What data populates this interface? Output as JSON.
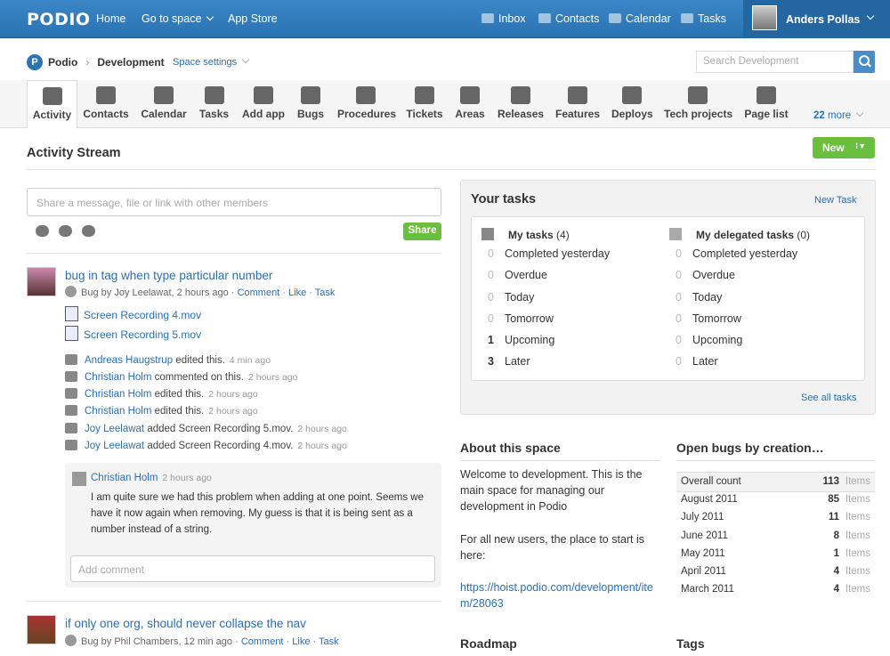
{
  "topbar": {
    "logo": "PODIO",
    "nav": [
      "Home",
      "Go to space",
      "App Store"
    ],
    "right_nav": [
      "Inbox",
      "Contacts",
      "Calendar",
      "Tasks"
    ],
    "user": "Anders Pollas"
  },
  "space": {
    "org": "Podio",
    "name": "Development",
    "settings": "Space settings",
    "search_placeholder": "Search Development"
  },
  "apps": [
    {
      "label": "Activity",
      "icon": "activity-icon"
    },
    {
      "label": "Contacts",
      "icon": "contacts-icon"
    },
    {
      "label": "Calendar",
      "icon": "calendar-icon"
    },
    {
      "label": "Tasks",
      "icon": "tasks-icon"
    },
    {
      "label": "Add app",
      "icon": "add-app-icon"
    },
    {
      "label": "Bugs",
      "icon": "bug-icon"
    },
    {
      "label": "Procedures",
      "icon": "book-icon"
    },
    {
      "label": "Tickets",
      "icon": "ticket-icon"
    },
    {
      "label": "Areas",
      "icon": "cloud-icon"
    },
    {
      "label": "Releases",
      "icon": "checkmark-icon"
    },
    {
      "label": "Features",
      "icon": "hammer-icon"
    },
    {
      "label": "Deploys",
      "icon": "home-icon"
    },
    {
      "label": "Tech projects",
      "icon": "tools-icon"
    },
    {
      "label": "Page list",
      "icon": "command-icon"
    }
  ],
  "more": {
    "count": "22",
    "label": "more"
  },
  "stream": {
    "title": "Activity Stream",
    "new_button": "New",
    "share_placeholder": "Share a message, file or link with other members",
    "share_button": "Share",
    "items": [
      {
        "title": "bug in tag when type particular number",
        "type": "Bug",
        "by": "by",
        "author": "Joy Leelawat",
        "time": "2 hours ago",
        "actions": [
          "Comment",
          "Like",
          "Task"
        ],
        "files": [
          "Screen Recording 4.mov",
          "Screen Recording 5.mov"
        ],
        "activity": [
          {
            "who": "Andreas Haugstrup",
            "what": "edited this.",
            "when": "4 min ago",
            "icon": "pencil-icon"
          },
          {
            "who": "Christian Holm",
            "what": "commented on this.",
            "when": "2 hours ago",
            "icon": "comment-icon"
          },
          {
            "who": "Christian Holm",
            "what": "edited this.",
            "when": "2 hours ago",
            "icon": "pencil-icon"
          },
          {
            "who": "Christian Holm",
            "what": "edited this.",
            "when": "2 hours ago",
            "icon": "pencil-icon"
          },
          {
            "who": "Joy Leelawat",
            "what": "added Screen Recording 5.mov.",
            "when": "2 hours ago",
            "icon": "paperclip-icon"
          },
          {
            "who": "Joy Leelawat",
            "what": "added Screen Recording 4.mov.",
            "when": "2 hours ago",
            "icon": "paperclip-icon"
          }
        ],
        "comment": {
          "author": "Christian Holm",
          "time": "2 hours ago",
          "text": "I am quite sure we had this problem when adding at one point. Seems we have it now again when removing. My guess is that it is being sent as a number instead of a string."
        },
        "add_comment_placeholder": "Add comment"
      },
      {
        "title": "if only one org, should never collapse the nav",
        "type": "Bug",
        "by": "by",
        "author": "Phil Chambers",
        "time": "12 min ago",
        "actions": [
          "Comment",
          "Like",
          "Task"
        ]
      }
    ]
  },
  "your_tasks": {
    "title": "Your tasks",
    "new_task": "New Task",
    "my": {
      "label": "My tasks",
      "count": "(4)"
    },
    "delegated": {
      "label": "My delegated tasks",
      "count": "(0)"
    },
    "rows": [
      "Completed yesterday",
      "Overdue",
      "Today",
      "Tomorrow",
      "Upcoming",
      "Later"
    ],
    "my_counts": [
      "0",
      "0",
      "0",
      "0",
      "1",
      "3"
    ],
    "delegated_counts": [
      "0",
      "0",
      "0",
      "0",
      "0",
      "0"
    ],
    "see_all": "See all tasks"
  },
  "about": {
    "title": "About this space",
    "p1": "Welcome to development. This is the main space for managing our development in Podio",
    "p2": "For all new users, the place to start is here:",
    "link": "https://hoist.podio.com/development/item/28063"
  },
  "bugs": {
    "title": "Open bugs by creation…",
    "unit": "Items",
    "rows": [
      {
        "label": "Overall count",
        "value": "113"
      },
      {
        "label": "August 2011",
        "value": "85"
      },
      {
        "label": "July 2011",
        "value": "11"
      },
      {
        "label": "June 2011",
        "value": "8"
      },
      {
        "label": "May 2011",
        "value": "1"
      },
      {
        "label": "April 2011",
        "value": "4"
      },
      {
        "label": "March 2011",
        "value": "4"
      }
    ]
  },
  "roadmap": {
    "title": "Roadmap"
  },
  "tags": {
    "title": "Tags"
  },
  "colors": {
    "accent": "#2b73b3",
    "green": "#6bbf3f",
    "link": "#2a6fb0"
  }
}
